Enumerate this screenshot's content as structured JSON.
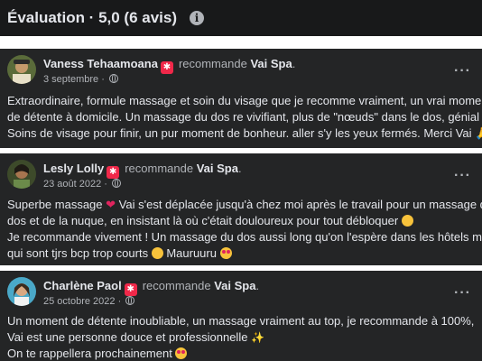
{
  "header": {
    "title": "Évaluation · 5,0 (6 avis)",
    "info_icon": "i"
  },
  "reviews": [
    {
      "author": "Vaness Tehaamoana",
      "recommends": "recommande",
      "page": "Vai Spa",
      "date": "3 septembre",
      "lines": [
        "Extraordinaire, formule massage et soin du visage que je recomme vraiment, un vrai moment",
        "de détente à domicile. Un massage du dos re vivifiant, plus de \"nœuds\" dans le dos, génial !",
        "Soins de visage pour finir, un pur moment de bonheur. aller s'y les yeux fermés. Merci Vai"
      ]
    },
    {
      "author": "Lesly Lolly",
      "recommends": "recommande",
      "page": "Vai Spa",
      "date": "23 août 2022",
      "lines": [
        "Superbe massage",
        "Vai s'est déplacée jusqu'à chez moi après le travail pour un massage du",
        "dos et de la nuque, en insistant là où c'était douloureux pour tout débloquer",
        "Je recommande vivement ! Un massage du dos aussi long qu'on l'espère dans les hôtels mais",
        "qui sont tjrs bcp trop courts",
        "Mauruuru"
      ]
    },
    {
      "author": "Charlène Paol",
      "recommends": "recommande",
      "page": "Vai Spa",
      "date": "25 octobre 2022",
      "lines": [
        "Un moment de détente inoubliable, un massage vraiment au top, je recommande à 100%,",
        "Vai est une personne douce et professionnelle",
        "On te rappellera prochainement"
      ]
    }
  ],
  "icons": {
    "recommend_badge": "recommend-badge-icon",
    "globe": "globe-icon",
    "more": "more-options-icon"
  },
  "colors": {
    "background": "#242526",
    "header_bg": "#18191a",
    "text": "#e4e6eb",
    "secondary": "#b0b3b8",
    "badge": "#f02849"
  }
}
